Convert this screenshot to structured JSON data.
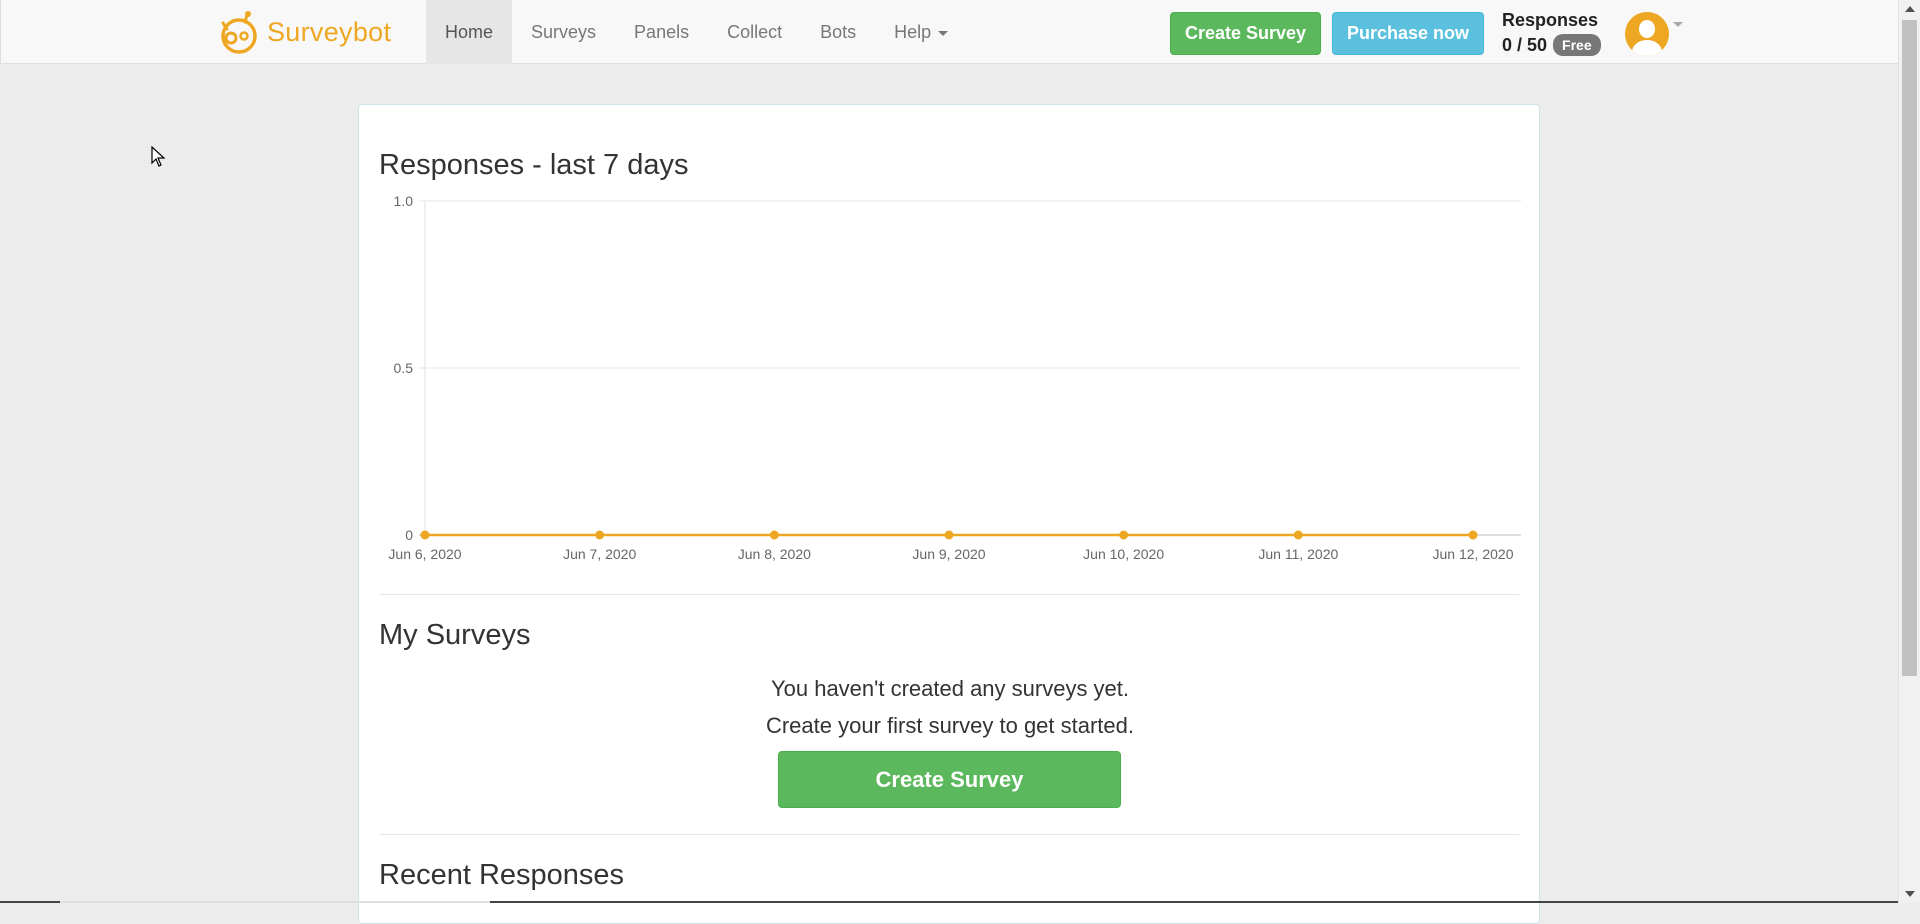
{
  "brand": {
    "name": "Surveybot",
    "color": "#eea722",
    "icon": "surveybot-logo-icon"
  },
  "nav": {
    "items": [
      {
        "label": "Home",
        "active": true
      },
      {
        "label": "Surveys"
      },
      {
        "label": "Panels"
      },
      {
        "label": "Collect"
      },
      {
        "label": "Bots"
      },
      {
        "label": "Help"
      }
    ]
  },
  "header": {
    "create_survey_label": "Create Survey",
    "purchase_label": "Purchase now",
    "responses_label": "Responses",
    "responses_count": "0 / 50",
    "plan_badge": "Free",
    "avatar_icon": "user-avatar-icon"
  },
  "chart_section": {
    "title": "Responses - last 7 days"
  },
  "chart_data": {
    "type": "line",
    "x": [
      "Jun 6, 2020",
      "Jun 7, 2020",
      "Jun 8, 2020",
      "Jun 9, 2020",
      "Jun 10, 2020",
      "Jun 11, 2020",
      "Jun 12, 2020"
    ],
    "series": [
      {
        "values": [
          0,
          0,
          0,
          0,
          0,
          0,
          0
        ],
        "color": "#eea722"
      }
    ],
    "yticks": [
      "0",
      "0.5",
      "1.0"
    ],
    "ylim": [
      0,
      1
    ],
    "grid": true
  },
  "my_surveys": {
    "title": "My Surveys",
    "empty_line1": "You haven't created any surveys yet.",
    "empty_line2": "Create your first survey to get started.",
    "create_button": "Create Survey"
  },
  "recent": {
    "title": "Recent Responses"
  },
  "colors": {
    "success": "#5cb85c",
    "info": "#5bc0de",
    "accent": "#eea722"
  }
}
